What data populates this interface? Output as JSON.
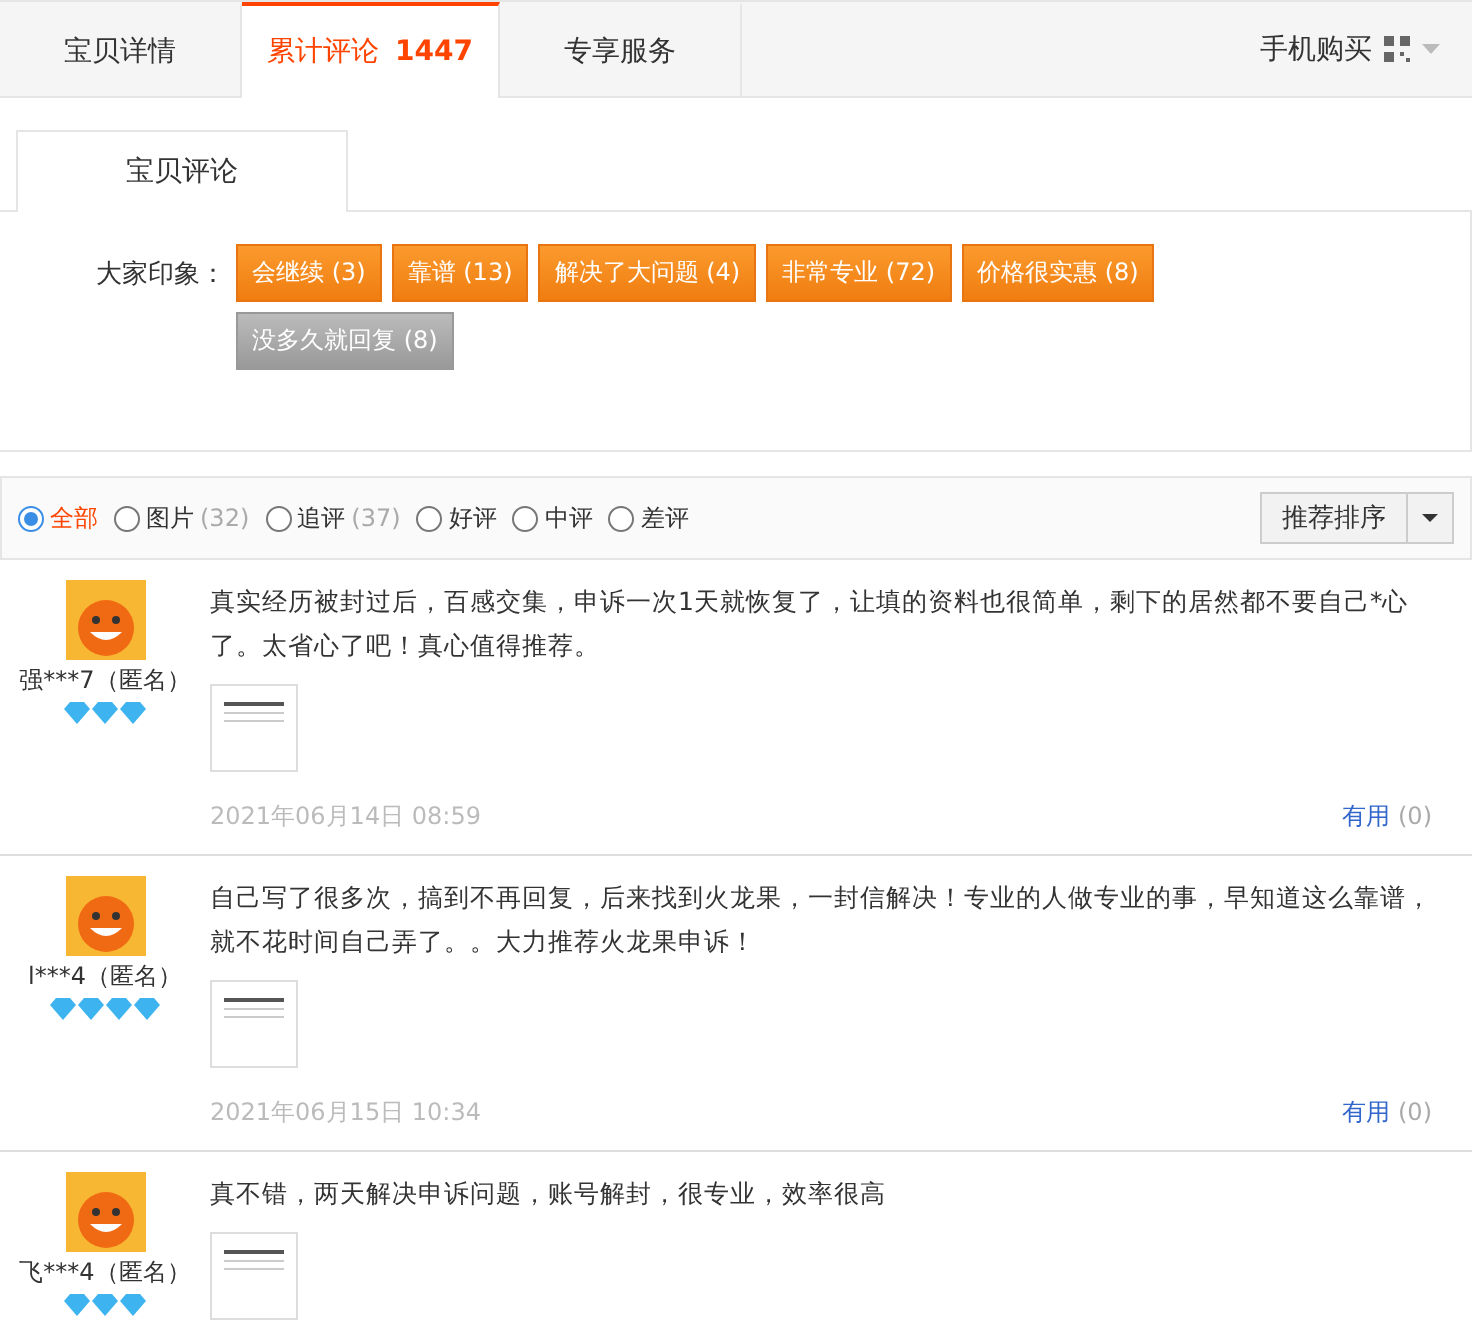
{
  "tabs": [
    {
      "label": "宝贝详情",
      "selected": false
    },
    {
      "label": "累计评论",
      "count": "1447",
      "selected": true
    },
    {
      "label": "专享服务",
      "selected": false
    }
  ],
  "mobile_buy": {
    "label": "手机购买"
  },
  "sub_tabs": [
    {
      "label": "宝贝评论",
      "selected": true
    }
  ],
  "impressions": {
    "label": "大家印象：",
    "tags": [
      {
        "text": "会继续 (3)",
        "kind": "positive"
      },
      {
        "text": "靠谱 (13)",
        "kind": "positive"
      },
      {
        "text": "解决了大问题 (4)",
        "kind": "positive"
      },
      {
        "text": "非常专业 (72)",
        "kind": "positive"
      },
      {
        "text": "价格很实惠 (8)",
        "kind": "positive"
      },
      {
        "text": "没多久就回复 (8)",
        "kind": "neutral"
      }
    ]
  },
  "filters": [
    {
      "label": "全部",
      "selected": true
    },
    {
      "label": "图片",
      "count": "(32)",
      "selected": false
    },
    {
      "label": "追评",
      "count": "(37)",
      "selected": false
    },
    {
      "label": "好评",
      "selected": false
    },
    {
      "label": "中评",
      "selected": false
    },
    {
      "label": "差评",
      "selected": false
    }
  ],
  "sort": {
    "label": "推荐排序"
  },
  "reviews": [
    {
      "user": "强***7（匿名）",
      "stars": 3,
      "text": "真实经历被封过后，百感交集，申诉一次1天就恢复了，让填的资料也很简单，剩下的居然都不要自己*心了。太省心了吧！真心值得推荐。",
      "date": "2021年06月14日 08:59",
      "useful": "有用",
      "useful_count": "(0)"
    },
    {
      "user": "l***4（匿名）",
      "stars": 4,
      "text": "自己写了很多次，搞到不再回复，后来找到火龙果，一封信解决！专业的人做专业的事，早知道这么靠谱，就不花时间自己弄了。。大力推荐火龙果申诉！",
      "date": "2021年06月15日 10:34",
      "useful": "有用",
      "useful_count": "(0)"
    },
    {
      "user": "飞***4（匿名）",
      "stars": 3,
      "text": "真不错，两天解决申诉问题，账号解封，很专业，效率很高"
    }
  ]
}
